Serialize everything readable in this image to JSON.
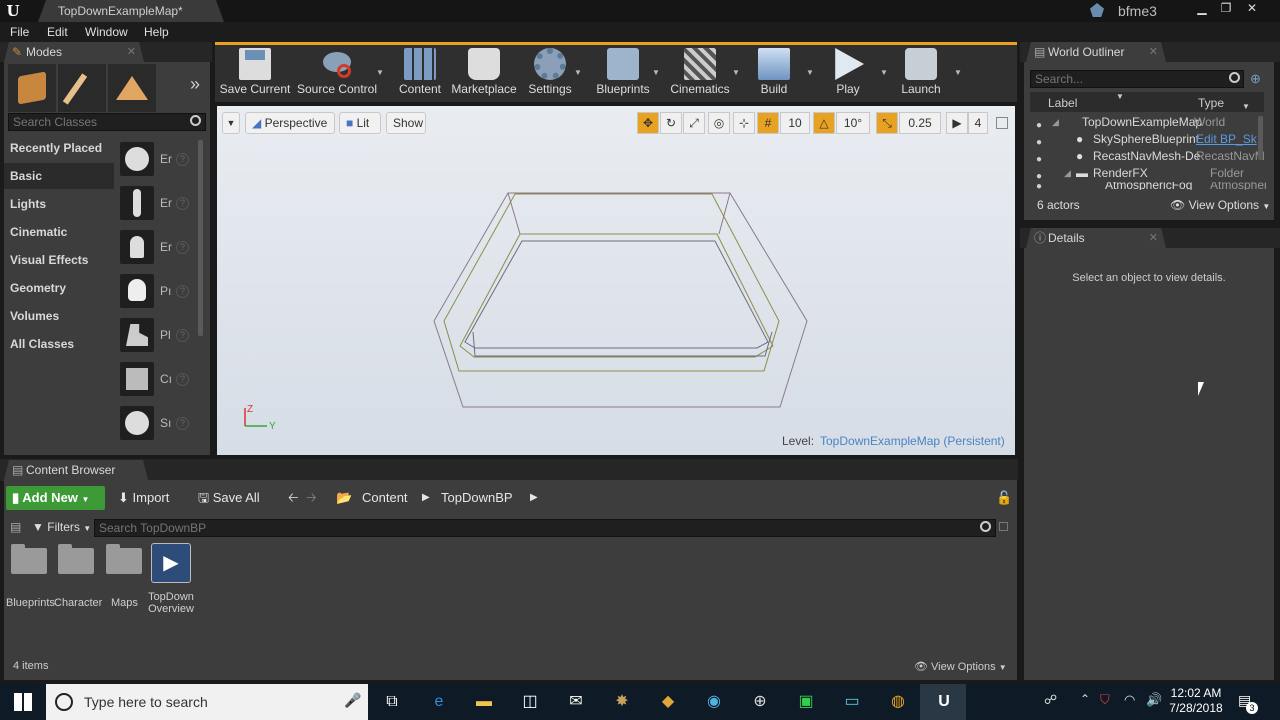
{
  "window": {
    "tab_title": "TopDownExampleMap*",
    "project": "bfme3",
    "min": "▁",
    "max": "❐",
    "close": "✕"
  },
  "menu": [
    "File",
    "Edit",
    "Window",
    "Help"
  ],
  "modes": {
    "tab": "Modes",
    "search_placeholder": "Search Classes",
    "categories": [
      "Recently Placed",
      "Basic",
      "Lights",
      "Cinematic",
      "Visual Effects",
      "Geometry",
      "Volumes",
      "All Classes"
    ],
    "items": [
      "Er",
      "Er",
      "Er",
      "Pı",
      "Pl",
      "Cı",
      "Sı"
    ],
    "more": "»"
  },
  "toolbar": [
    "Save Current",
    "Source Control",
    "Content",
    "Marketplace",
    "Settings",
    "Blueprints",
    "Cinematics",
    "Build",
    "Play",
    "Launch"
  ],
  "viewport": {
    "perspective": "Perspective",
    "lit": "Lit",
    "show": "Show",
    "grid_snap": "10",
    "rot_snap": "10°",
    "scale_snap": "0.25",
    "cam_speed": "4",
    "level_label": "Level:",
    "level_name": "TopDownExampleMap (Persistent)"
  },
  "content_browser": {
    "tab": "Content Browser",
    "add_new": "Add New",
    "import": "Import",
    "save_all": "Save All",
    "path": [
      "Content",
      "TopDownBP"
    ],
    "filters": "Filters",
    "search_placeholder": "Search TopDownBP",
    "assets": [
      "Blueprints",
      "Character",
      "Maps",
      "TopDown\nOverview"
    ],
    "count": "4 items",
    "view_options": "View Options"
  },
  "outliner": {
    "tab": "World Outliner",
    "search_placeholder": "Search...",
    "col_label": "Label",
    "col_type": "Type",
    "rows": [
      {
        "label": "TopDownExampleMap",
        "type": "World"
      },
      {
        "label": "SkySphereBlueprint",
        "type": "Edit BP_Sk"
      },
      {
        "label": "RecastNavMesh-De",
        "type": "RecastNavM"
      },
      {
        "label": "RenderFX",
        "type": "Folder"
      },
      {
        "label": "AtmosphericFog",
        "type": "Atmospheri"
      }
    ],
    "count": "6 actors",
    "view_options": "View Options"
  },
  "details": {
    "tab": "Details",
    "message": "Select an object to view details."
  },
  "taskbar": {
    "search_placeholder": "Type here to search",
    "time": "12:02 AM",
    "date": "7/28/2018",
    "notifications": "3"
  }
}
